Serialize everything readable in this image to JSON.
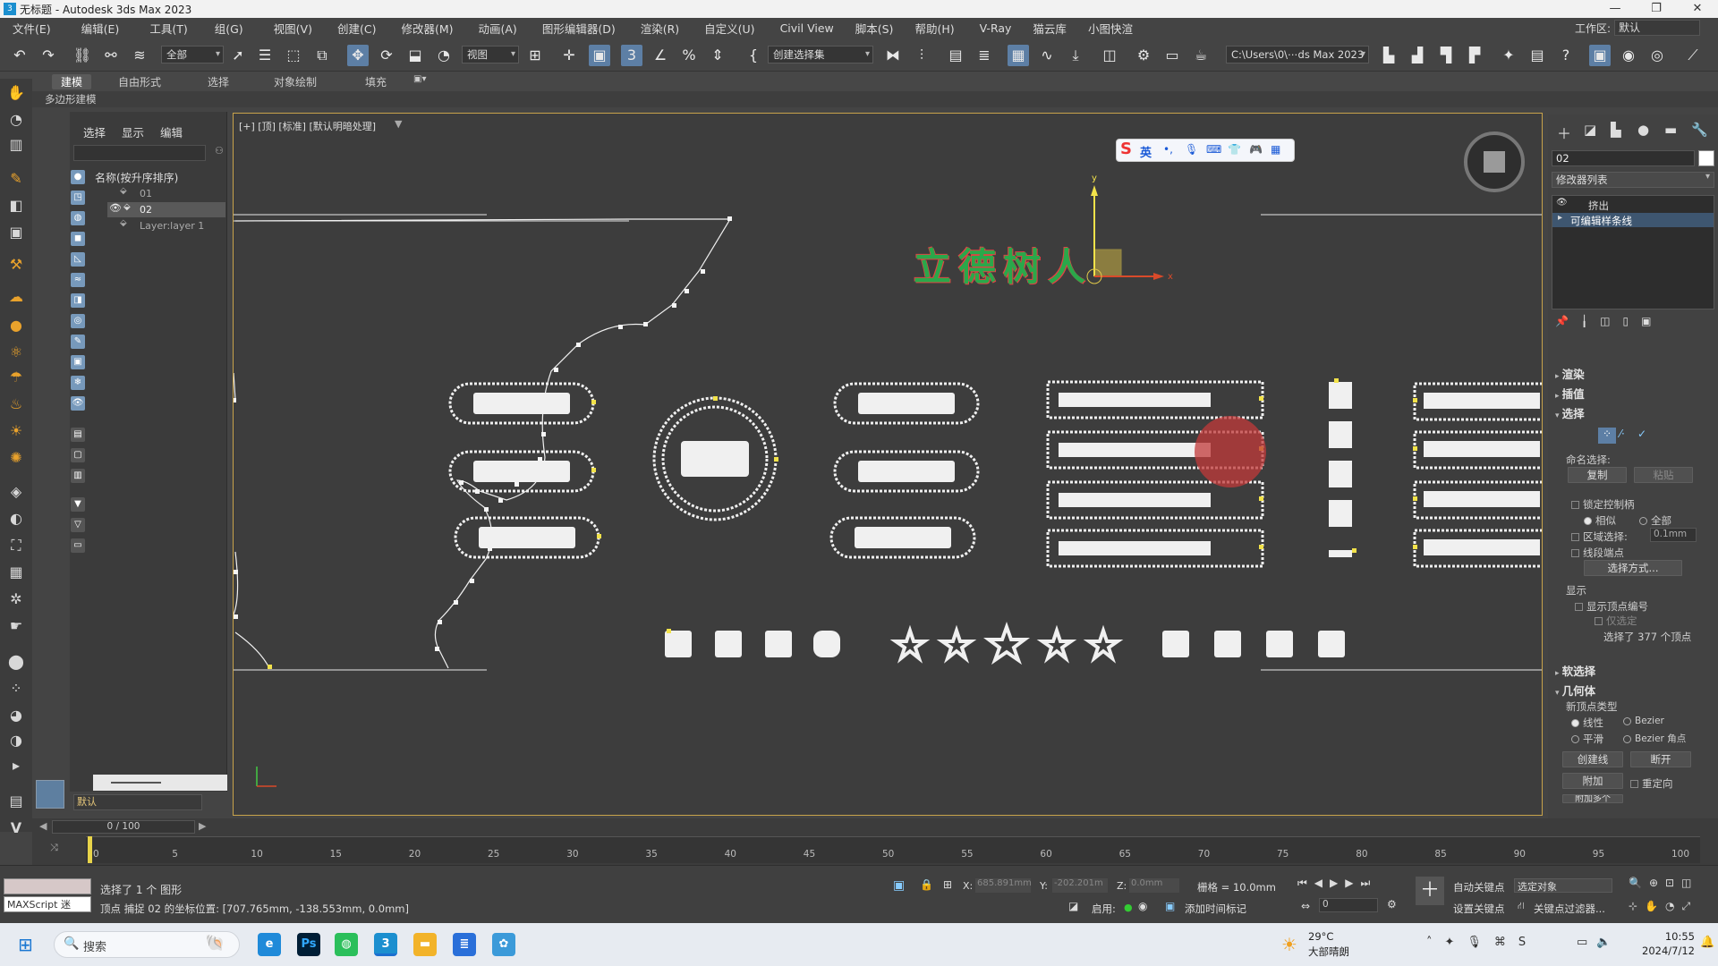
{
  "title_bar": {
    "icon": "3",
    "title": "无标题 - Autodesk 3ds Max 2023"
  },
  "menu": [
    "文件(E)",
    "编辑(E)",
    "工具(T)",
    "组(G)",
    "视图(V)",
    "创建(C)",
    "修改器(M)",
    "动画(A)",
    "图形编辑器(D)",
    "渲染(R)",
    "自定义(U)",
    "Civil View",
    "脚本(S)",
    "帮助(H)",
    "V-Ray",
    "猫云库",
    "小图快渲"
  ],
  "workspace": {
    "label": "工作区:",
    "value": "默认"
  },
  "toolbar": {
    "filter": "全部",
    "refcoord": "视图",
    "selset": "创建选择集",
    "path": "C:\\Users\\0\\⋯ds Max 2023"
  },
  "ribbon": {
    "tabs": [
      "建模",
      "自由形式",
      "选择",
      "对象绘制",
      "填充"
    ],
    "sub": "多边形建模"
  },
  "scene_explorer": {
    "tabs": [
      "选择",
      "显示",
      "编辑"
    ],
    "column": "名称(按升序排序)",
    "items": [
      "01",
      "02",
      "Layer:layer 1"
    ],
    "layer_field": "默认"
  },
  "viewport": {
    "label": "[+] [顶] [标准] [默认明暗处理]",
    "title_text": "立德树人",
    "ime": "英"
  },
  "right_panel": {
    "name": "02",
    "modifier_list": "修改器列表",
    "stack": [
      "挤出",
      "可编辑样条线"
    ],
    "rollouts": {
      "render": "渲染",
      "interp": "插值",
      "select": "选择",
      "soft": "软选择",
      "geom": "几何体"
    },
    "named_sel": "命名选择:",
    "copy": "复制",
    "paste": "粘贴",
    "lock": "锁定控制柄",
    "similar": "相似",
    "all": "全部",
    "area_sel": "区域选择:",
    "area_val": "0.1mm",
    "seg_end": "线段端点",
    "sel_by": "选择方式...",
    "display": "显示",
    "show_vnum": "显示顶点编号",
    "only_sel": "仅选定",
    "sel_count": "选择了 377 个顶点",
    "new_vtype": "新顶点类型",
    "linear": "线性",
    "bezier": "Bezier",
    "smooth": "平滑",
    "bezier_corner": "Bezier 角点",
    "create_line": "创建线",
    "break": "断开",
    "attach": "附加",
    "reorient": "重定向",
    "attach_multi": "附加多个"
  },
  "timeline": {
    "frame": "0 / 100",
    "ticks": [
      "0",
      "5",
      "10",
      "15",
      "20",
      "25",
      "30",
      "35",
      "40",
      "45",
      "50",
      "55",
      "60",
      "65",
      "70",
      "75",
      "80",
      "85",
      "90",
      "95",
      "100"
    ]
  },
  "status": {
    "maxscript": "MAXScript 迷",
    "selected": "选择了 1 个 图形",
    "prompt": "顶点 捕捉 02 的坐标位置: [707.765mm, -138.553mm, 0.0mm]",
    "x_label": "X:",
    "x": "685.891mm",
    "y_label": "Y:",
    "y": "-202.201m",
    "z_label": "Z:",
    "z": "0.0mm",
    "grid": "栅格 = 10.0mm",
    "enable": "启用:",
    "add_time": "添加时间标记",
    "autokey": "自动关键点",
    "setkey": "设置关键点",
    "sel_obj": "选定对象",
    "keyfilter": "关键点过滤器...",
    "frame_val": "0"
  },
  "taskbar": {
    "search": "搜索",
    "weather_temp": "29°C",
    "weather_desc": "大部晴朗",
    "time": "10:55",
    "date": "2024/7/12"
  }
}
